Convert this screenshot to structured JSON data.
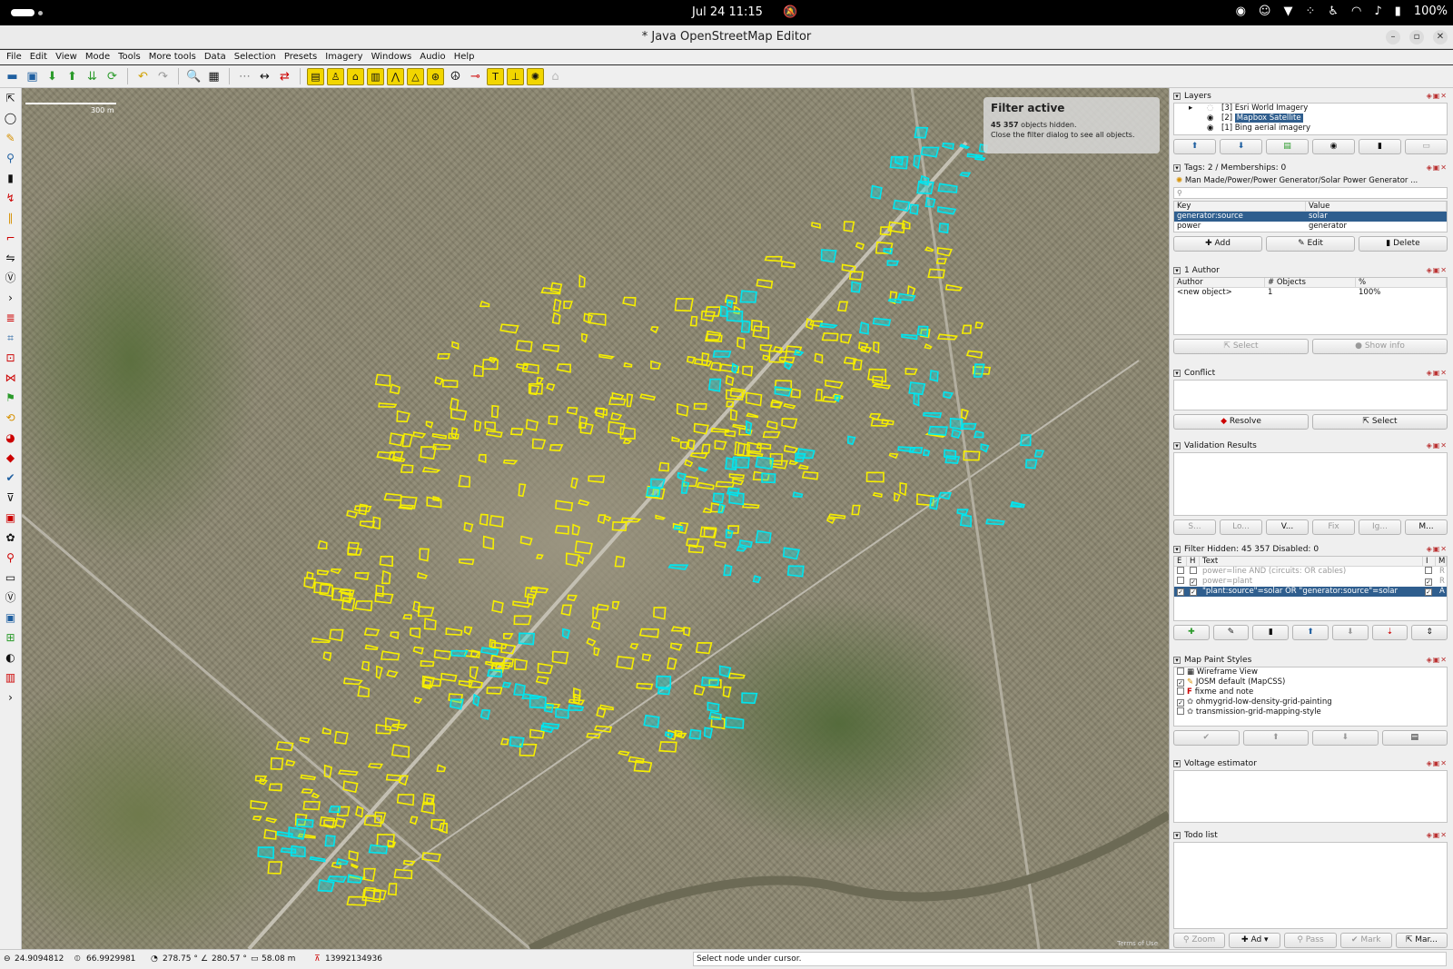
{
  "system": {
    "clock": "Jul 24  11:15",
    "battery": "100%"
  },
  "window": {
    "title": "* Java OpenStreetMap Editor"
  },
  "menu": [
    "File",
    "Edit",
    "View",
    "Mode",
    "Tools",
    "More tools",
    "Data",
    "Selection",
    "Presets",
    "Imagery",
    "Windows",
    "Audio",
    "Help"
  ],
  "map": {
    "scale_label": "300 m",
    "filter": {
      "heading": "Filter active",
      "hidden_count": "45 357",
      "hidden_suffix": " objects hidden.",
      "hint": "Close the filter dialog to see all objects."
    },
    "attribution": "Terms of Use"
  },
  "layers": {
    "title": "Layers",
    "items": [
      {
        "index": "[3]",
        "name": "Esri World Imagery"
      },
      {
        "index": "[2]",
        "name": "Mapbox Satellite"
      },
      {
        "index": "[1]",
        "name": "Bing aerial imagery"
      }
    ]
  },
  "tags": {
    "title": "Tags: 2 / Memberships: 0",
    "preset": "Man Made/Power/Power Generator/Solar Power Generator ...",
    "col_key": "Key",
    "col_value": "Value",
    "rows": [
      {
        "key": "generator:source",
        "value": "solar"
      },
      {
        "key": "power",
        "value": "generator"
      }
    ],
    "buttons": {
      "add": "Add",
      "edit": "Edit",
      "delete": "Delete"
    }
  },
  "authors": {
    "title": "1 Author",
    "col_author": "Author",
    "col_objects": "# Objects",
    "col_pct": "%",
    "rows": [
      {
        "author": "<new object>",
        "objects": "1",
        "pct": "100%"
      }
    ],
    "buttons": {
      "select": "Select",
      "show_info": "Show info"
    }
  },
  "conflict": {
    "title": "Conflict",
    "buttons": {
      "resolve": "Resolve",
      "select": "Select"
    }
  },
  "validation": {
    "title": "Validation Results",
    "buttons": [
      "S...",
      "Lo...",
      "V...",
      "Fix",
      "Ig...",
      "M..."
    ]
  },
  "filters": {
    "title": "Filter Hidden: 45 357 Disabled: 0",
    "col_e": "E",
    "col_h": "H",
    "col_text": "Text",
    "col_i": "I",
    "col_m": "M",
    "rows": [
      {
        "text": "power=line AND (circuits: OR cables)",
        "mode": "R"
      },
      {
        "text": "power=plant",
        "mode": "R"
      },
      {
        "text": "\"plant:source\"=solar OR \"generator:source\"=solar",
        "mode": "A"
      }
    ]
  },
  "paint_styles": {
    "title": "Map Paint Styles",
    "items": [
      {
        "name": "Wireframe View",
        "checked": false
      },
      {
        "name": "JOSM default (MapCSS)",
        "checked": true
      },
      {
        "name": "fixme and note",
        "checked": false
      },
      {
        "name": "ohmygrid-low-density-grid-painting",
        "checked": true
      },
      {
        "name": "transmission-grid-mapping-style",
        "checked": false
      }
    ]
  },
  "voltage": {
    "title": "Voltage estimator"
  },
  "todo": {
    "title": "Todo list",
    "buttons": [
      "Zoom",
      "Ad",
      "Pass",
      "Mark",
      "Mar..."
    ]
  },
  "status": {
    "lat": "24.9094812",
    "lon": "66.9929981",
    "heading": "278.75 °",
    "angle": "280.57 °",
    "distance": "58.08 m",
    "object_id": "13992134936",
    "message": "Select node under cursor."
  },
  "colors": {
    "highlight_yellow": "#f6ee00",
    "highlight_cyan": "#00e5ef",
    "selection": "#2f5e8e"
  }
}
